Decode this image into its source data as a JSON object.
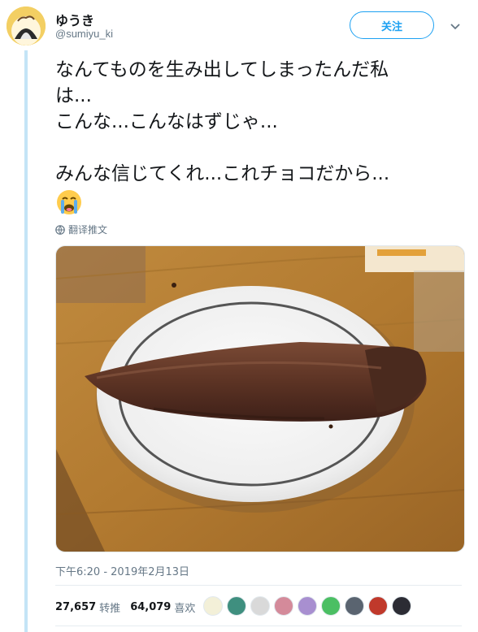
{
  "user": {
    "display_name": "ゆうき",
    "handle": "@sumiyu_ki",
    "follow_label": "关注"
  },
  "tweet": {
    "lines_block1": [
      "なんてものを生み出してしまったんだ私",
      "は...",
      "こんな...こんなはずじゃ..."
    ],
    "lines_block2": [
      "みんな信じてくれ...これチョコだから..."
    ],
    "emoji_icon": "loudly-crying-face-icon",
    "translate_label": "翻译推文",
    "timestamp": "下午6:20 - 2019年2月13日"
  },
  "stats": {
    "retweets": "27,657",
    "retweets_label": "转推",
    "likes": "64,079",
    "likes_label": "喜欢"
  },
  "liker_avatars": [
    {
      "name": "liker-avatar-1",
      "color": "#f3f0d8"
    },
    {
      "name": "liker-avatar-2",
      "color": "#3f8f7f"
    },
    {
      "name": "liker-avatar-3",
      "color": "#d9d9d9"
    },
    {
      "name": "liker-avatar-4",
      "color": "#d48a9a"
    },
    {
      "name": "liker-avatar-5",
      "color": "#a88fd0"
    },
    {
      "name": "liker-avatar-6",
      "color": "#4bbf63"
    },
    {
      "name": "liker-avatar-7",
      "color": "#5a6470"
    },
    {
      "name": "liker-avatar-8",
      "color": "#c0392b"
    },
    {
      "name": "liker-avatar-9",
      "color": "#2c2c34"
    }
  ],
  "colors": {
    "accent": "#1da1f2",
    "secondary_text": "#657786",
    "thread_line": "#c4e4f6"
  }
}
